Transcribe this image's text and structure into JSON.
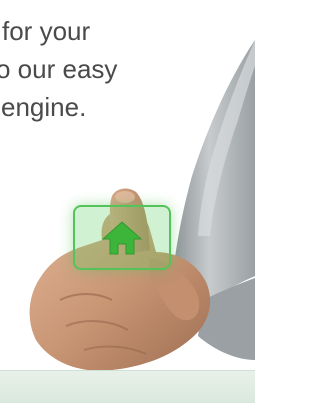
{
  "headline": {
    "lines": [
      "for your",
      "o our easy",
      "engine."
    ]
  },
  "home_button": {
    "icon": "home-icon",
    "accent_color": "#56c25a",
    "icon_color": "#3db43a"
  },
  "colors": {
    "text": "#4a4a4a",
    "footer_band": "#e8f1e9",
    "sleeve": "#b6bbbe",
    "skin": "#c99674"
  }
}
